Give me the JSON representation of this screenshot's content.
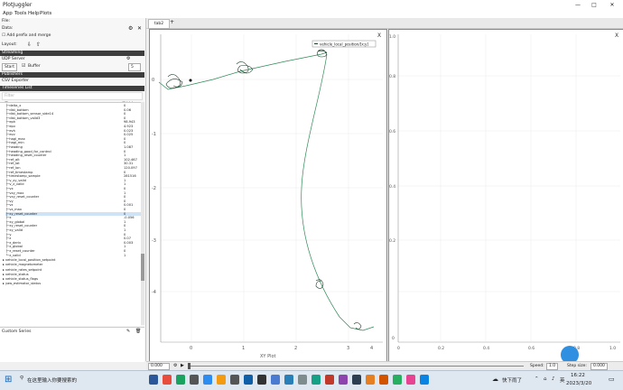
{
  "window": {
    "title": "PlotJuggler",
    "controls": [
      "—",
      "□",
      "✕"
    ]
  },
  "menu": [
    "App",
    "Tools",
    "Help",
    "Plots"
  ],
  "sidebar": {
    "file_label": "File:",
    "data_label": "Data:",
    "checkbox_label": "Add prefix and merge",
    "layout_label": "Layout:",
    "streaming_header": "Streaming",
    "udp_label": "UDP Server",
    "start_btn": "Start",
    "buffer_label": "Buffer",
    "buffer_value": "5",
    "publishers_header": "Publishers",
    "csv_exporter": "CSV Exporter",
    "timeseries_header": "Timeseries List",
    "filter_placeholder": "Filter",
    "count_text": "2279 of 2279",
    "values_label": "Values",
    "rows": [
      {
        "n": "├─delta_x",
        "v": "0"
      },
      {
        "n": "├─dist_bottom",
        "v": "0.06"
      },
      {
        "n": "├─dist_bottom_sensor_side14",
        "v": "0"
      },
      {
        "n": "├─dist_bottom_valid3",
        "v": "0"
      },
      {
        "n": "├─eph",
        "v": "98.943"
      },
      {
        "n": "├─epv",
        "v": "4.923"
      },
      {
        "n": "├─evh",
        "v": "0.023"
      },
      {
        "n": "├─evv",
        "v": "0.025"
      },
      {
        "n": "├─hagl_max",
        "v": "0"
      },
      {
        "n": "├─hagl_min",
        "v": "0"
      },
      {
        "n": "├─heading",
        "v": "1.087"
      },
      {
        "n": "├─heading_good_for_control",
        "v": "0"
      },
      {
        "n": "├─heading_reset_counter",
        "v": "1"
      },
      {
        "n": "├─ref_alt",
        "v": "102.467"
      },
      {
        "n": "├─ref_lat",
        "v": "30.31"
      },
      {
        "n": "├─ref_lon",
        "v": "120.097"
      },
      {
        "n": "├─ref_timestamp",
        "v": "0"
      },
      {
        "n": "├─timestamp_sample",
        "v": "281516"
      },
      {
        "n": "├─v_xy_valid",
        "v": "1"
      },
      {
        "n": "├─v_z_valid",
        "v": "1"
      },
      {
        "n": "├─vx",
        "v": "0"
      },
      {
        "n": "├─vxy_max",
        "v": "1"
      },
      {
        "n": "├─vxy_reset_counter",
        "v": "0"
      },
      {
        "n": "├─vy",
        "v": "0"
      },
      {
        "n": "├─vz",
        "v": "0.001"
      },
      {
        "n": "├─vz_max",
        "v": "0"
      },
      {
        "n": "├─xy_reset_counter",
        "v": "0"
      },
      {
        "n": "├─x",
        "v": "-0.056"
      },
      {
        "n": "├─xy_global",
        "v": "1"
      },
      {
        "n": "├─xy_reset_counter",
        "v": "0"
      },
      {
        "n": "├─xy_valid",
        "v": "1"
      },
      {
        "n": "├─y",
        "v": "0"
      },
      {
        "n": "├─z",
        "v": "0.07"
      },
      {
        "n": "├─z_deriv",
        "v": "0.003"
      },
      {
        "n": "├─z_global",
        "v": "1"
      },
      {
        "n": "├─z_reset_counter",
        "v": "0"
      },
      {
        "n": "└─z_valid",
        "v": "1"
      }
    ],
    "groups": [
      "▸ vehicle_local_position_setpoint",
      "▸ vehicle_magnetometer",
      "▸ vehicle_rates_setpoint",
      "▸ vehicle_status",
      "▸ vehicle_status_flags",
      "▸ yaw_estimator_status"
    ],
    "custom_series": "Custom Series"
  },
  "tabs": {
    "active": "tab2",
    "add": "+"
  },
  "plot1": {
    "close": "X",
    "legend": "vehicle_local_position/[x;y]",
    "xlabel": "XY Plot",
    "xticks": [
      "0",
      "1",
      "2",
      "3",
      "4"
    ],
    "yticks": [
      "0",
      "-1",
      "-2",
      "-3",
      "-4"
    ]
  },
  "plot2": {
    "close": "X",
    "yticks": [
      "1.0",
      "0.8",
      "0.6",
      "0.4",
      "0.2",
      "0"
    ],
    "xticks": [
      "0",
      "0.2",
      "0.4",
      "0.6",
      "0.8",
      "1.0"
    ]
  },
  "bottom": {
    "time_value": "0.000",
    "speed_label": "Speed:",
    "speed_value": "1.0",
    "step_label": "Step size:",
    "step_value": "0.000"
  },
  "taskbar": {
    "search": "在这里输入你要搜索的",
    "weather": "快下雨了",
    "time": "16:22",
    "date": "2023/3/20",
    "lang": "英"
  }
}
